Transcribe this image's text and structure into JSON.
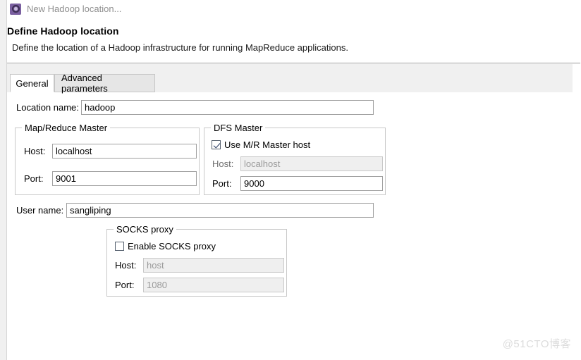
{
  "window": {
    "title": "New Hadoop location...",
    "title_icon": "hadoop-gear-icon"
  },
  "header": {
    "title": "Define Hadoop location",
    "description": "Define the location of a Hadoop infrastructure for running MapReduce applications."
  },
  "tabs": [
    {
      "label": "General",
      "active": true
    },
    {
      "label": "Advanced parameters",
      "active": false
    }
  ],
  "general": {
    "location_name": {
      "label": "Location name:",
      "value": "hadoop",
      "placeholder": ""
    },
    "mapreduce_master": {
      "title": "Map/Reduce Master",
      "host": {
        "label": "Host:",
        "value": "localhost",
        "disabled": false
      },
      "port": {
        "label": "Port:",
        "value": "9001",
        "disabled": false
      }
    },
    "dfs_master": {
      "title": "DFS Master",
      "use_mr_master_host": {
        "label": "Use M/R Master host",
        "checked": true
      },
      "host": {
        "label": "Host:",
        "value": "localhost",
        "disabled": true
      },
      "port": {
        "label": "Port:",
        "value": "9000",
        "disabled": false
      }
    },
    "user_name": {
      "label": "User name:",
      "value": "sangliping",
      "placeholder": ""
    },
    "socks_proxy": {
      "title": "SOCKS proxy",
      "enable": {
        "label": "Enable SOCKS proxy",
        "checked": false
      },
      "host": {
        "label": "Host:",
        "value": "host",
        "disabled": true
      },
      "port": {
        "label": "Port:",
        "value": "1080",
        "disabled": true
      }
    }
  },
  "watermark": {
    "text": "@51CTO博客"
  },
  "colors": {
    "accent": "#7a5fa0",
    "checkmark": "#22355e",
    "border": "#c8c8c8",
    "tab_strip": "#f0f0f0",
    "disabled_bg": "#efefef",
    "disabled_text": "#9a9a9a"
  }
}
